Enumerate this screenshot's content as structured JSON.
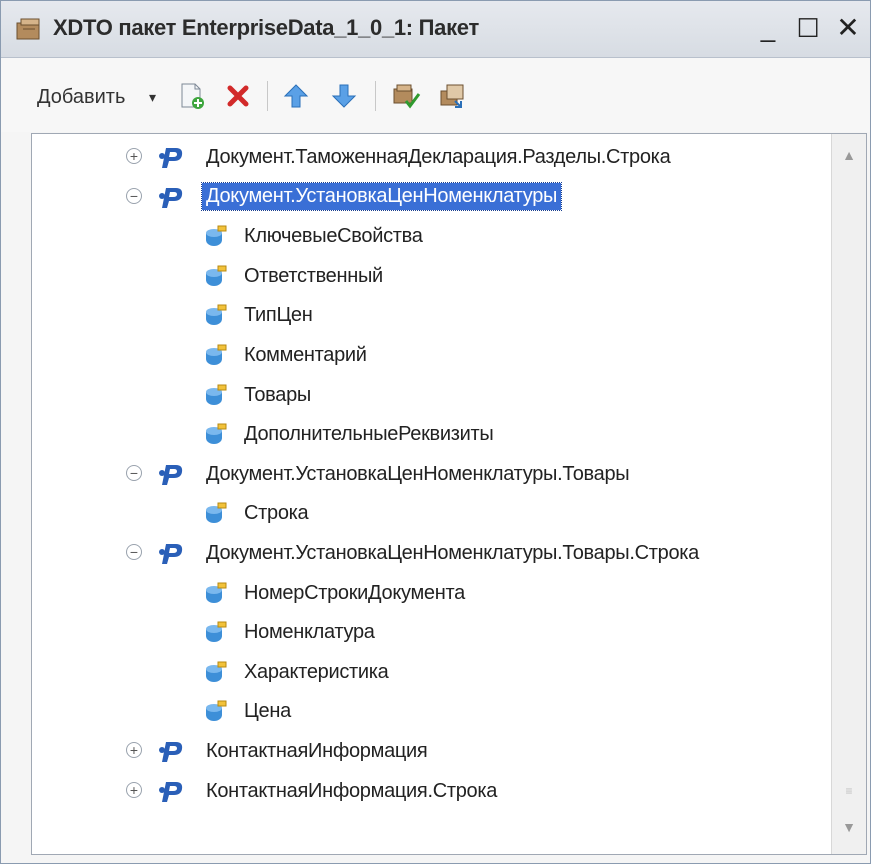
{
  "window": {
    "title": "XDTO пакет EnterpriseData_1_0_1: Пакет",
    "minimize_glyph": "_",
    "maximize_glyph": "☐",
    "close_glyph": "✕"
  },
  "toolbar": {
    "add_label": "Добавить",
    "add_arrow": "▾",
    "buttons": [
      "add-document-icon",
      "delete-icon",
      "move-up-icon",
      "move-down-icon",
      "check-icon",
      "copy-icon"
    ]
  },
  "tree": {
    "items": [
      {
        "label": "Документ.ТаможеннаяДекларация.Разделы.Строка",
        "type": "package",
        "expander": "+"
      },
      {
        "label": "Документ.УстановкаЦенНоменклатуры",
        "type": "package",
        "expander": "−",
        "selected": true
      },
      {
        "label": "КлючевыеСвойства",
        "type": "property"
      },
      {
        "label": "Ответственный",
        "type": "property"
      },
      {
        "label": "ТипЦен",
        "type": "property"
      },
      {
        "label": "Комментарий",
        "type": "property"
      },
      {
        "label": "Товары",
        "type": "property"
      },
      {
        "label": "ДополнительныеРеквизиты",
        "type": "property"
      },
      {
        "label": "Документ.УстановкаЦенНоменклатуры.Товары",
        "type": "package",
        "expander": "−"
      },
      {
        "label": "Строка",
        "type": "property"
      },
      {
        "label": "Документ.УстановкаЦенНоменклатуры.Товары.Строка",
        "type": "package",
        "expander": "−"
      },
      {
        "label": "НомерСтрокиДокумента",
        "type": "property"
      },
      {
        "label": "Номенклатура",
        "type": "property"
      },
      {
        "label": "Характеристика",
        "type": "property"
      },
      {
        "label": "Цена",
        "type": "property"
      },
      {
        "label": "КонтактнаяИнформация",
        "type": "package",
        "expander": "+"
      },
      {
        "label": "КонтактнаяИнформация.Строка",
        "type": "package",
        "expander": "+"
      }
    ]
  },
  "scrollbar": {
    "up": "▲",
    "down": "▼"
  },
  "colors": {
    "selection": "#3a6fd6",
    "package_icon": "#2a5fb8",
    "property_icon": "#3d8fd8",
    "delete": "#d22a2a"
  }
}
